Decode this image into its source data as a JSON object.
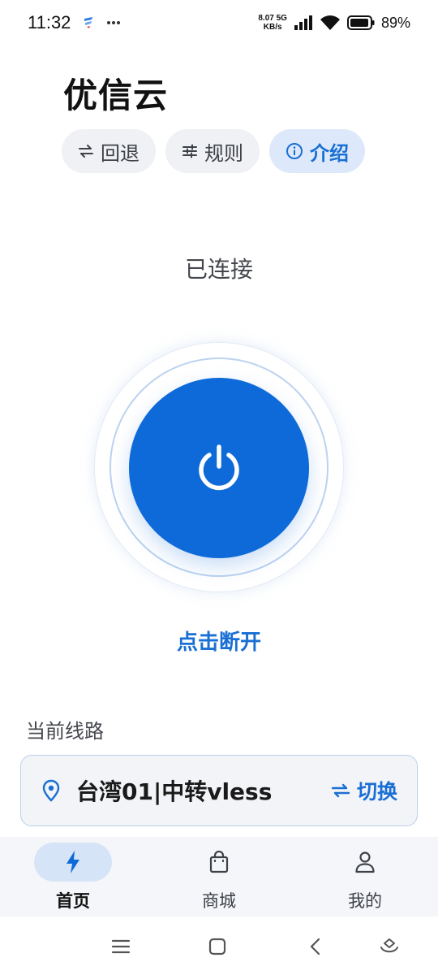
{
  "status_bar": {
    "time": "11:32",
    "net_speed_value": "8.07",
    "net_speed_unit": "KB/s",
    "network_type": "5G",
    "battery": "89%"
  },
  "header": {
    "title": "优信云",
    "chips": [
      {
        "label": "回退",
        "icon": "swap-arrows-icon",
        "active": false
      },
      {
        "label": "规则",
        "icon": "sliders-icon",
        "active": false
      },
      {
        "label": "介绍",
        "icon": "info-icon",
        "active": true
      }
    ]
  },
  "connection": {
    "status_text": "已连接",
    "action_text": "点击断开",
    "accent_color": "#0e6ad8"
  },
  "route": {
    "section_label": "当前线路",
    "name": "台湾01|中转vless",
    "switch_label": "切换"
  },
  "bottom_nav": {
    "items": [
      {
        "label": "首页",
        "icon": "lightning-icon",
        "active": true
      },
      {
        "label": "商城",
        "icon": "shopping-bag-icon",
        "active": false
      },
      {
        "label": "我的",
        "icon": "person-icon",
        "active": false
      }
    ]
  }
}
